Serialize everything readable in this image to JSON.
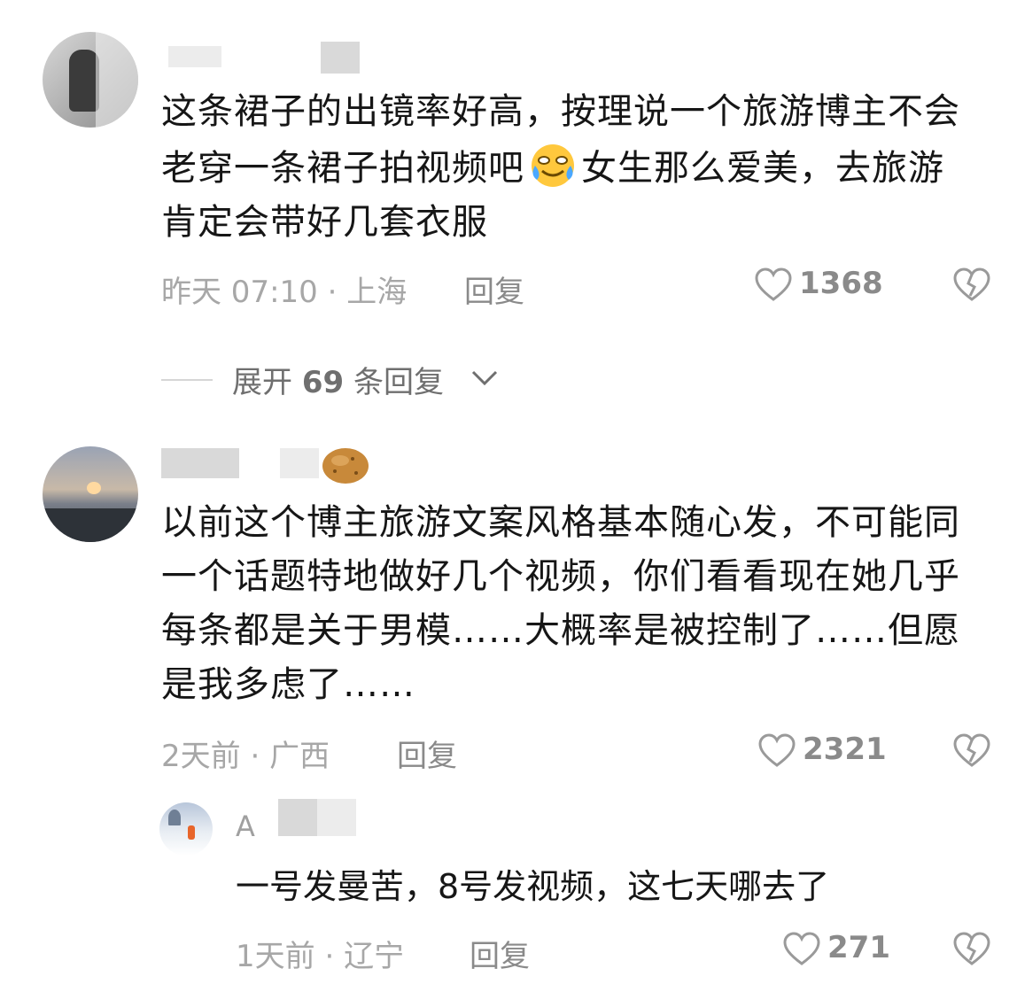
{
  "comments": [
    {
      "name_initial": "",
      "text": "这条裙子的出镜率好高，按理说一个旅游博主不会老穿一条裙子拍视频吧😭女生那么爱美，去旅游肯定会带好几套衣服",
      "time": "昨天 07:10",
      "location": "上海",
      "reply_label": "回复",
      "likes": "1368",
      "expand_prefix": "展开",
      "expand_count": "69",
      "expand_suffix": "条回复"
    },
    {
      "text": "以前这个博主旅游文案风格基本随心发，不可能同一个话题特地做好几个视频，你们看看现在她几乎每条都是关于男模……大概率是被控制了……但愿是我多虑了……",
      "time": "2天前",
      "location": "广西",
      "reply_label": "回复",
      "likes": "2321"
    }
  ],
  "sub_reply": {
    "name_initial": "A",
    "text": "一号发曼苦，8号发视频，这七天哪去了",
    "time": "1天前",
    "location": "辽宁",
    "reply_label": "回复",
    "likes": "271"
  },
  "icons": {
    "like": "heart-outline-icon",
    "dislike": "broken-heart-icon",
    "expand": "chevron-down-icon",
    "emoji": "crying-laughing-emoji-icon",
    "name_emoji": "potato-emoji-icon"
  }
}
